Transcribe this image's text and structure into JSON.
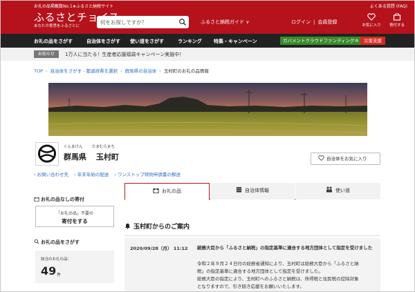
{
  "header": {
    "tagline": "お礼の品掲載数No.1★ふるさと納税サイト",
    "faq": "よくある質問 (FAQ)",
    "logo": "ふるさとチョイス",
    "logo_sub": "あなたの意思をふるさとに",
    "search_placeholder": "何をお探しですか？",
    "guide": "ふるさと納税ガイド ∨",
    "login": "ログイン",
    "register": "会員登録",
    "favorites": "お気に入り",
    "cart": "寄付する"
  },
  "nav": {
    "items": [
      "お礼の品をさがす",
      "自治体をさがす",
      "使い道をさがす",
      "ランキング",
      "特集・キャンペーン"
    ],
    "gcf": "ガバメントクラウドファンディング®",
    "disaster": "災害支援"
  },
  "announcement": {
    "badge": "お知らせ",
    "text": "1万人に当たる！生産者応援福袋キャンペーン実施中！"
  },
  "breadcrumb": [
    "TOP",
    "自治体をさがす - 都道府県を選択",
    "群馬県の自治体",
    "玉村町のお礼の品情報"
  ],
  "municipality": {
    "pref_kana": "ぐんまけん",
    "town_kana": "たまむらまち",
    "pref": "群馬県",
    "town": "玉村町",
    "favorite_button": "自治体をお気に入り",
    "links": [
      "› お問い合わせ先",
      "› 年末年始の配送",
      "› ワンストップ特例申請書の郵送"
    ]
  },
  "sidebar": {
    "donate_heading": "お礼の品なしの寄付",
    "donate_line1": "「お礼の品」不要の",
    "donate_line2": "寄付をする",
    "search_heading": "お礼の品をさがす",
    "count_label": "該当のお礼の品：",
    "count": "49",
    "count_unit": "件"
  },
  "tabs": [
    {
      "label": "お礼の品"
    },
    {
      "label": "自治体情報"
    },
    {
      "label": "使い道"
    }
  ],
  "news": {
    "heading": "玉村町からのご案内",
    "date": "2020/09/28（月） 11:12",
    "title": "総務大臣から「ふるさと納税」の指定基準に適合する地方団体として指定を受けました",
    "body": [
      "令和２年９月２４日付の総務省通知により、玉村町は総務大臣から「ふるさと納",
      "税」の指定基準に適合する地方団体として指定を受けました。",
      "総務大臣の指定により、玉村町へのふるさと納税は、所得税と住民税の控除対象",
      "となりますので、引き続き応援をお願いいたします。"
    ]
  },
  "colors": {
    "brand_red": "#b5121b",
    "nav_dark": "#222222",
    "link_blue": "#2a6ebd",
    "gcf_green": "#3a8a2b"
  }
}
